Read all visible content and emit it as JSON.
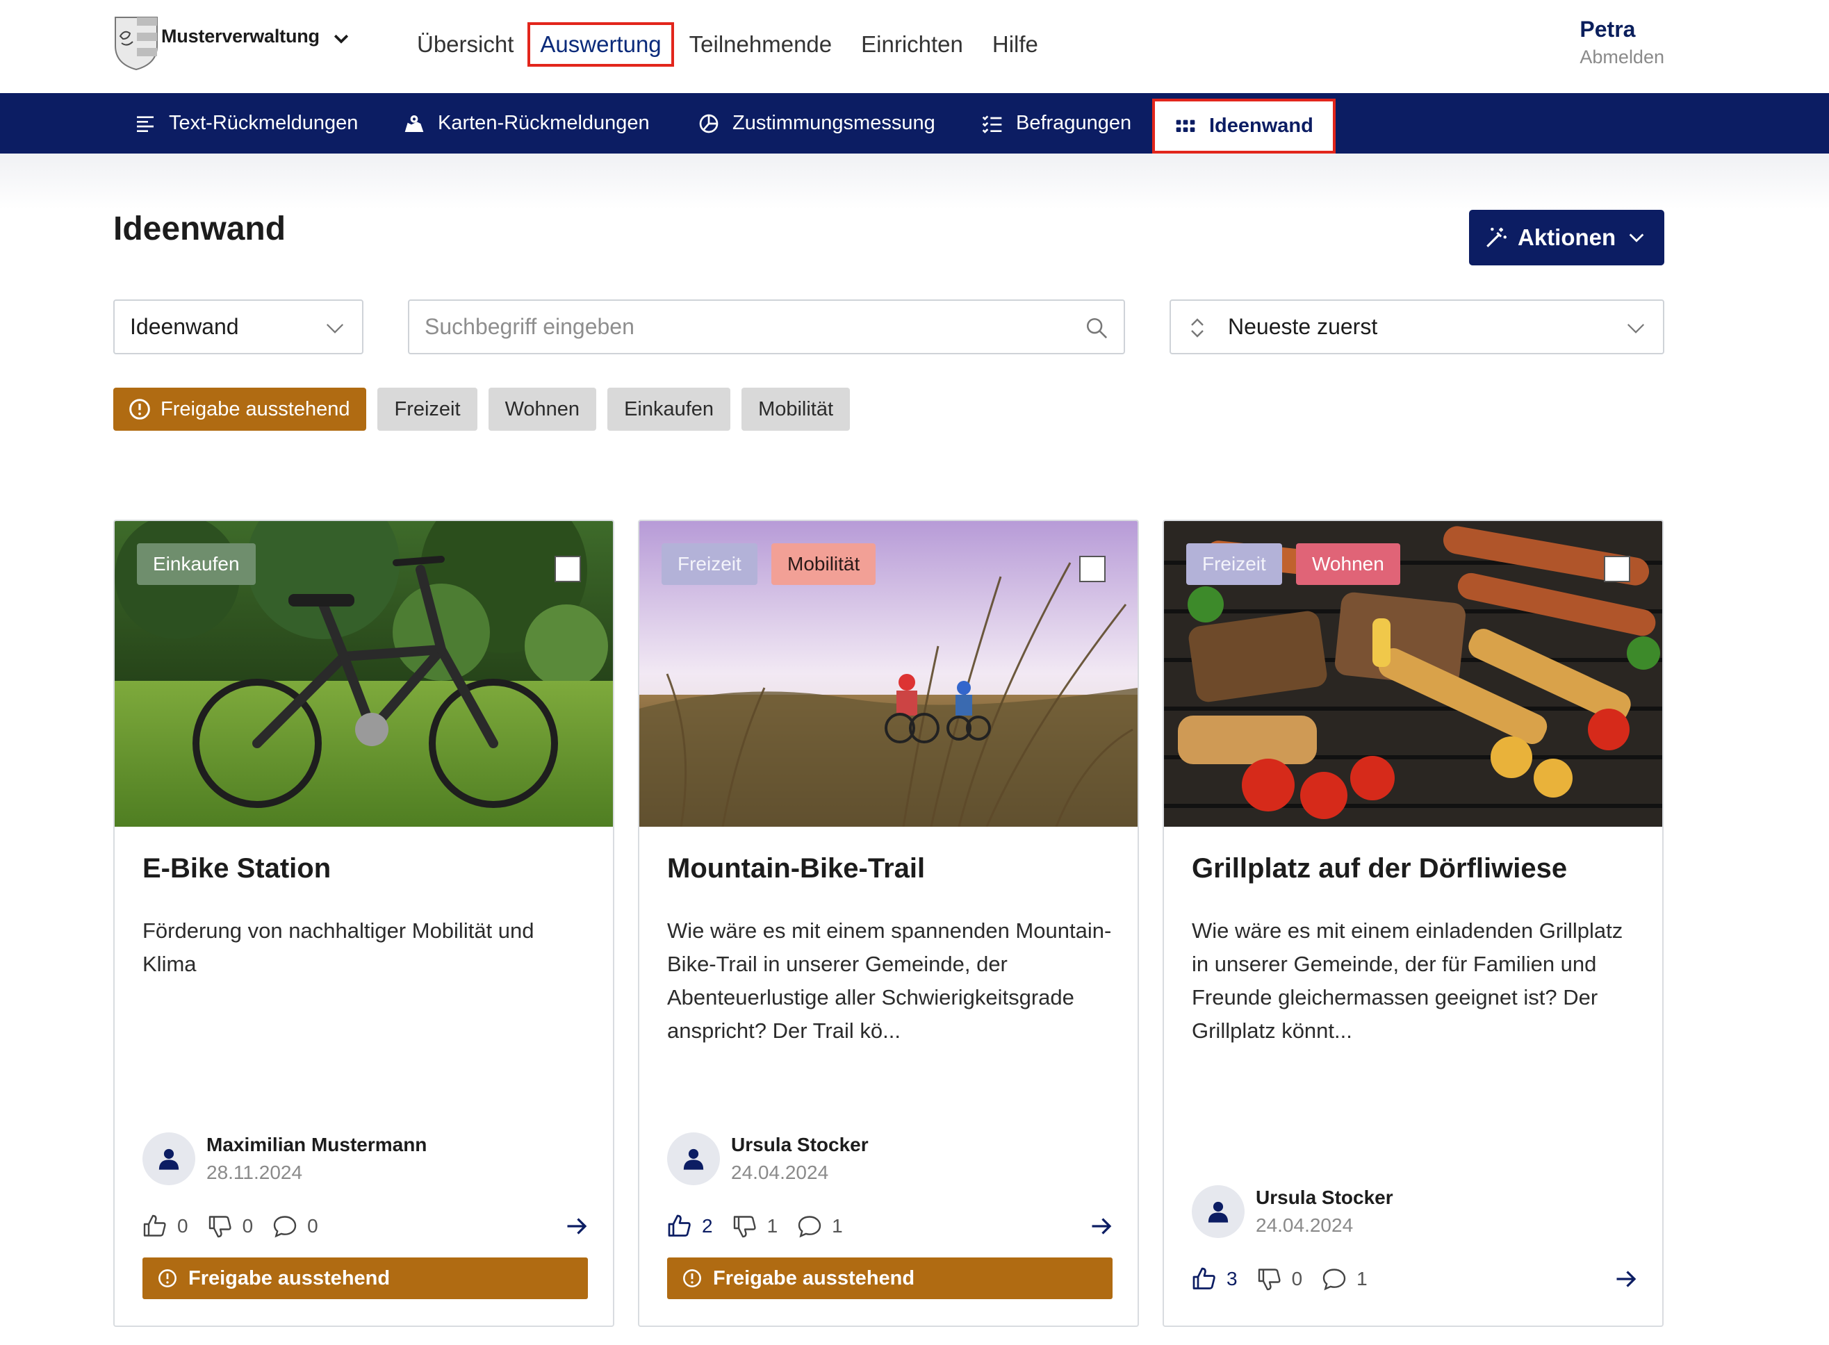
{
  "header": {
    "brand": "Musterverwaltung",
    "nav": [
      "Übersicht",
      "Auswertung",
      "Teilnehmende",
      "Einrichten",
      "Hilfe"
    ],
    "user": {
      "name": "Petra",
      "logout": "Abmelden"
    }
  },
  "subnav": {
    "items": [
      "Text-Rückmeldungen",
      "Karten-Rückmeldungen",
      "Zustimmungsmessung",
      "Befragungen",
      "Ideenwand"
    ]
  },
  "page": {
    "title": "Ideenwand",
    "actions_label": "Aktionen"
  },
  "filters": {
    "view_select": "Ideenwand",
    "search_placeholder": "Suchbegriff eingeben",
    "sort_select": "Neueste zuerst",
    "chips": [
      "Freigabe ausstehend",
      "Freizeit",
      "Wohnen",
      "Einkaufen",
      "Mobilität"
    ]
  },
  "cards": [
    {
      "tags": [
        "Einkaufen"
      ],
      "title": "E-Bike Station",
      "description": "Förderung von nachhaltiger Mobilität und Klima",
      "author": "Maximilian Mustermann",
      "date": "28.11.2024",
      "likes": "0",
      "dislikes": "0",
      "comments": "0",
      "status": "Freigabe ausstehend"
    },
    {
      "tags": [
        "Freizeit",
        "Mobilität"
      ],
      "title": "Mountain-Bike-Trail",
      "description": "Wie wäre es mit einem spannenden Mountain-Bike-Trail in unserer Gemeinde, der Abenteuerlustige aller Schwierigkeitsgrade anspricht? Der Trail kö...",
      "author": "Ursula Stocker",
      "date": "24.04.2024",
      "likes": "2",
      "dislikes": "1",
      "comments": "1",
      "status": "Freigabe ausstehend"
    },
    {
      "tags": [
        "Freizeit",
        "Wohnen"
      ],
      "title": "Grillplatz auf der Dörfliwiese",
      "description": "Wie wäre es mit einem einladenden Grillplatz in unserer Gemeinde, der für Familien und Freunde gleichermassen geeignet ist? Der Grillplatz könnt...",
      "author": "Ursula Stocker",
      "date": "24.04.2024",
      "likes": "3",
      "dislikes": "0",
      "comments": "1"
    }
  ],
  "colors": {
    "navy": "#0c1d63",
    "highlight_red": "#e2261c",
    "pending_amber": "#b06b12",
    "chip_gray": "#d9d9d9"
  }
}
